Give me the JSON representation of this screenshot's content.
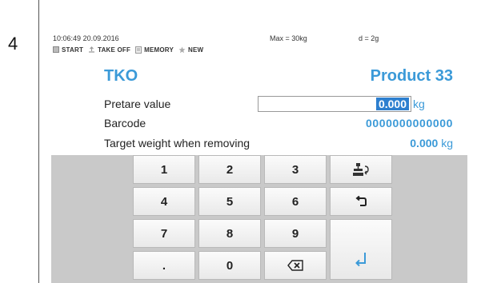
{
  "page": {
    "step_number": "4"
  },
  "status": {
    "time": "10:06:49",
    "date": "20.09.2016",
    "max": "Max = 30kg",
    "d": "d = 2g"
  },
  "menu": [
    {
      "label": "START",
      "icon": "square-icon"
    },
    {
      "label": "TAKE OFF",
      "icon": "take-off-icon"
    },
    {
      "label": "MEMORY",
      "icon": "memory-icon"
    },
    {
      "label": "NEW",
      "icon": "star-icon"
    }
  ],
  "header": {
    "mode": "TKO",
    "product": "Product 33"
  },
  "fields": {
    "pretare_label": "Pretare value",
    "pretare_value": "0.000",
    "pretare_unit": "kg",
    "barcode_label": "Barcode",
    "barcode_value": "0000000000000",
    "target_label": "Target weight when removing",
    "target_value": "0.000",
    "target_unit": "kg"
  },
  "keypad": {
    "keys": [
      "1",
      "2",
      "3",
      "4",
      "5",
      "6",
      "7",
      "8",
      "9",
      ".",
      "0"
    ],
    "special_icons": [
      "scale-tare-icon",
      "back-icon",
      "backspace-icon",
      "enter-icon"
    ]
  },
  "colors": {
    "accent": "#3b9ad8",
    "selection": "#2d7fcf",
    "keypad_bg": "#c9c9c9"
  }
}
